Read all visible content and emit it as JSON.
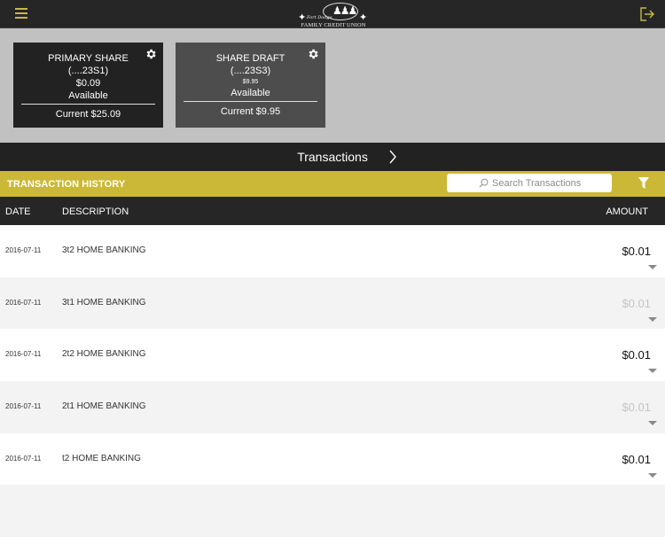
{
  "header": {
    "logo": {
      "script_text": "Fort Dodge",
      "name": "FAMILY CREDIT UNION"
    },
    "menu_icon": "hamburger-icon",
    "logout_icon": "logout-icon"
  },
  "accounts": [
    {
      "name": "PRIMARY SHARE",
      "number": "(....23S1)",
      "available": "$0.09",
      "available_label": "Available",
      "current": "Current $25.09"
    },
    {
      "name": "SHARE DRAFT",
      "number": "(....23S3)",
      "available": "$9.95",
      "available_label": "Available",
      "current": "Current $9.95"
    }
  ],
  "transactions_nav": {
    "label": "Transactions"
  },
  "history": {
    "title": "TRANSACTION HISTORY",
    "search_placeholder": "Search Transactions",
    "accent_color": "#ccb837"
  },
  "columns": {
    "date": "DATE",
    "description": "DESCRIPTION",
    "amount": "AMOUNT"
  },
  "transactions": [
    {
      "date": "2016-07-11",
      "description": "3t2 HOME BANKING",
      "amount": "$0.01",
      "pending": false
    },
    {
      "date": "2016-07-11",
      "description": "3t1 HOME BANKING",
      "amount": "$0.01",
      "pending": true
    },
    {
      "date": "2016-07-11",
      "description": "2t2 HOME BANKING",
      "amount": "$0.01",
      "pending": false
    },
    {
      "date": "2016-07-11",
      "description": "2t1 HOME BANKING",
      "amount": "$0.01",
      "pending": true
    },
    {
      "date": "2016-07-11",
      "description": "t2 HOME BANKING",
      "amount": "$0.01",
      "pending": false
    }
  ]
}
